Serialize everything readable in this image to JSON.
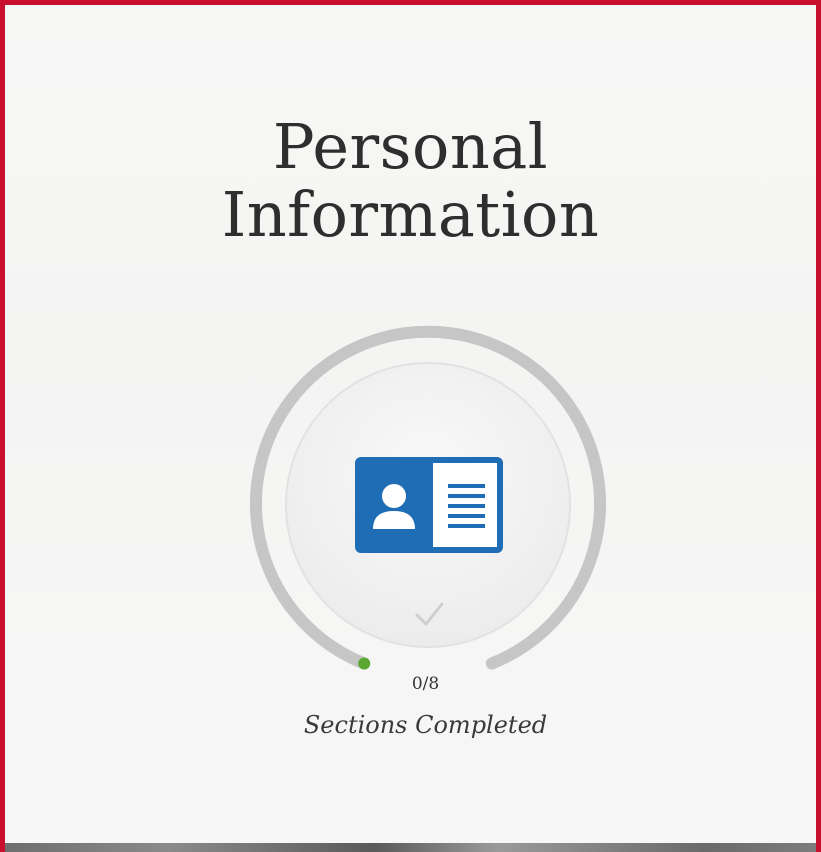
{
  "card": {
    "title_line1": "Personal",
    "title_line2": "Information",
    "icon": "id-card-icon",
    "check_icon": "checkmark-icon",
    "progress": {
      "completed": 0,
      "total": 8,
      "label": "0/8",
      "caption": "Sections Completed"
    }
  },
  "colors": {
    "border": "#c8102e",
    "ring": "#c4c4c4",
    "progress_dot": "#5aa832",
    "icon_blue": "#1f6db5",
    "title": "#2e2e2e"
  }
}
